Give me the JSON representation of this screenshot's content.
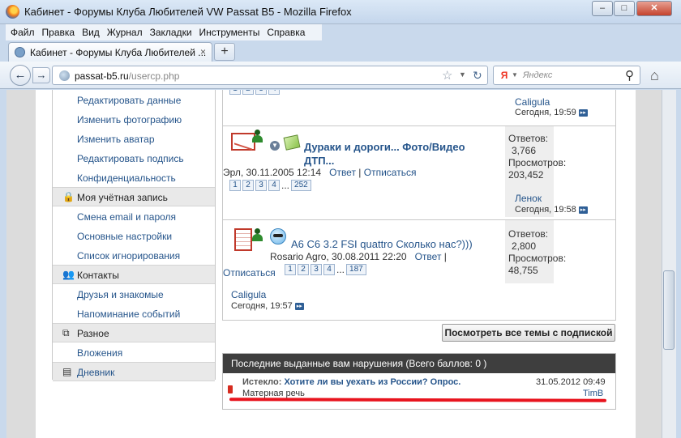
{
  "window": {
    "title": "Кабинет - Форумы Клуба Любителей VW Passat B5 - Mozilla Firefox",
    "minimize": "–",
    "maximize": "□",
    "close": "✕"
  },
  "menu": [
    "Файл",
    "Правка",
    "Вид",
    "Журнал",
    "Закладки",
    "Инструменты",
    "Справка"
  ],
  "tab": {
    "label": "Кабинет - Форумы Клуба Любителей ...",
    "close": "×",
    "newtab": "+"
  },
  "nav": {
    "url_host": "passat-b5.ru",
    "url_path": "/usercp.php",
    "search_placeholder": "Яндекс",
    "search_engine_icon": "Я"
  },
  "sidebar": {
    "top_items": [
      "Редактировать данные",
      "Изменить фотографию",
      "Изменить аватар",
      "Редактировать подпись",
      "Конфиденциальность"
    ],
    "account_header": "Моя учётная запись",
    "account_items": [
      "Смена email и пароля",
      "Основные настройки",
      "Список игнорирования"
    ],
    "contacts_header": "Контакты",
    "contacts_items": [
      "Друзья и знакомые",
      "Напоминание событий"
    ],
    "misc_header": "Разное",
    "misc_items": [
      "Вложения"
    ],
    "diary_header": "Дневник"
  },
  "threads": [
    {
      "last_user": "Caligula",
      "last_time": "Сегодня, 19:59"
    },
    {
      "title_line1": "Дураки и дороги... Фото/Видео",
      "title_line2": "ДТП...",
      "author_date": "Эрл, 30.11.2005 12:14",
      "reply": "Ответ",
      "unsubscribe": "Отписаться",
      "pages": [
        "1",
        "2",
        "3",
        "4"
      ],
      "pages_dots": "...",
      "last_page": "252",
      "replies_label": "Ответов:",
      "replies": "3,766",
      "views_label": "Просмотров:",
      "views": "203,452",
      "last_user": "Ленок",
      "last_time": "Сегодня, 19:58"
    },
    {
      "title": "A6 C6 3.2 FSI quattro Сколько нас?)))",
      "author_date": "Rosario Agro, 30.08.2011 22:20",
      "reply": "Ответ",
      "unsubscribe": "Отписаться",
      "pages": [
        "1",
        "2",
        "3",
        "4"
      ],
      "pages_dots": "...",
      "last_page": "187",
      "replies_label": "Ответов:",
      "replies": "2,800",
      "views_label": "Просмотров:",
      "views": "48,755",
      "last_user": "Caligula",
      "last_time": "Сегодня, 19:57"
    }
  ],
  "view_all_button": "Посмотреть все темы с подпиской",
  "warnings": {
    "header": "Последние выданные вам нарушения (Всего баллов: 0 )",
    "status": "Истекло:",
    "title": "Хотите ли вы уехать из России? Опрос.",
    "date": "31.05.2012 09:49",
    "reason": "Матерная речь",
    "moderator": "TimB",
    "highlight_color": "#e8141e"
  }
}
